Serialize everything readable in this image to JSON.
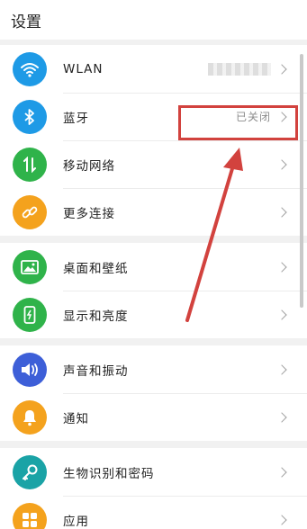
{
  "header": {
    "title": "设置"
  },
  "groups": [
    {
      "items": [
        {
          "label": "WLAN",
          "icon": "wifi-icon",
          "color": "#1e9ae6"
        },
        {
          "label": "蓝牙",
          "value": "已关闭",
          "icon": "bluetooth-icon",
          "color": "#1e9ae6"
        },
        {
          "label": "移动网络",
          "icon": "mobile-data-icon",
          "color": "#2fb34a"
        },
        {
          "label": "更多连接",
          "icon": "link-icon",
          "color": "#f4a21d"
        }
      ]
    },
    {
      "items": [
        {
          "label": "桌面和壁纸",
          "icon": "wallpaper-icon",
          "color": "#2fb34a"
        },
        {
          "label": "显示和亮度",
          "icon": "display-icon",
          "color": "#2fb34a"
        }
      ]
    },
    {
      "items": [
        {
          "label": "声音和振动",
          "icon": "volume-icon",
          "color": "#3d5fd8"
        },
        {
          "label": "通知",
          "icon": "bell-icon",
          "color": "#f4a21d"
        }
      ]
    },
    {
      "items": [
        {
          "label": "生物识别和密码",
          "icon": "key-icon",
          "color": "#1aa3a6"
        },
        {
          "label": "应用",
          "icon": "apps-icon",
          "color": "#f4a21d"
        }
      ]
    }
  ],
  "annotation": {
    "color": "#d2423e"
  }
}
